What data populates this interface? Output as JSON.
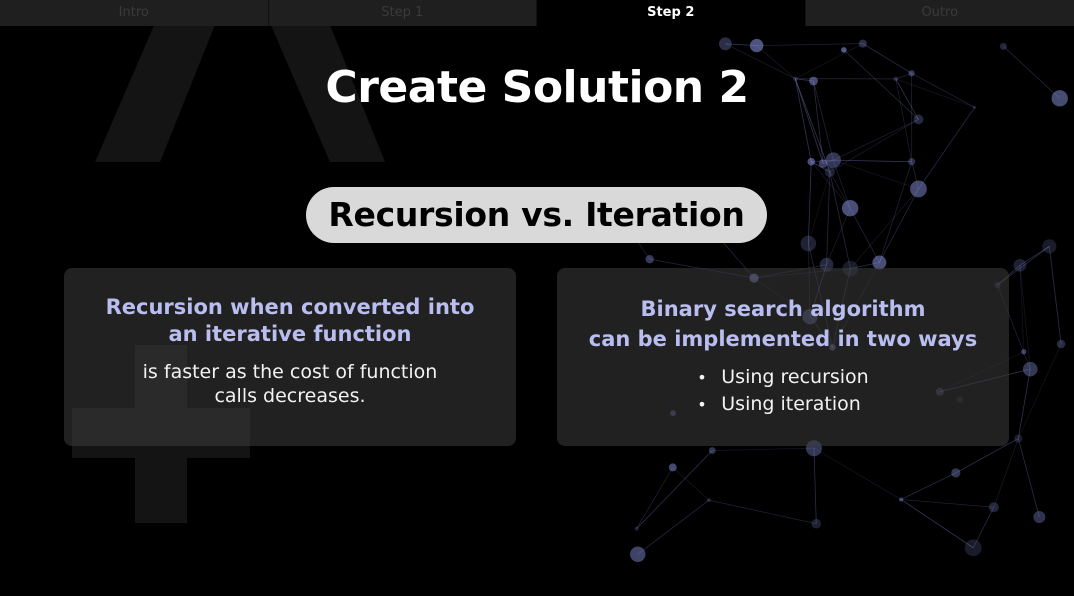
{
  "tabs": [
    {
      "label": "Intro",
      "active": false
    },
    {
      "label": "Step 1",
      "active": false
    },
    {
      "label": "Step 2",
      "active": true
    },
    {
      "label": "Outro",
      "active": false
    }
  ],
  "slide": {
    "title": "Create Solution 2",
    "subtitle": "Recursion vs. Iteration",
    "left_card": {
      "heading_lines": [
        "Recursion when converted into",
        "an iterative function"
      ],
      "body_lines": [
        "is faster as the cost of function",
        "calls decreases."
      ]
    },
    "right_card": {
      "heading_lines": [
        "Binary search algorithm",
        "can be implemented in two ways"
      ],
      "bullet_glyph": "•",
      "bullets": [
        "Using recursion",
        "Using iteration"
      ]
    }
  },
  "colors": {
    "background": "#000000",
    "heading_accent": "#b9bdf0",
    "pill_background": "#d9d9d9",
    "card_background": "#3c3c3c",
    "network_nodes": "#8a93e0"
  },
  "icons": {
    "background_network": "network-graph-icon"
  }
}
